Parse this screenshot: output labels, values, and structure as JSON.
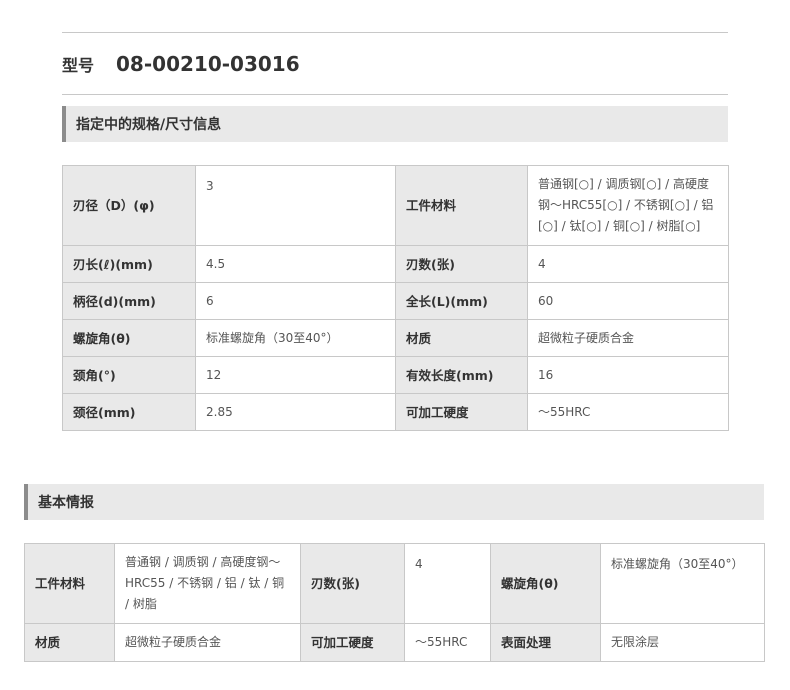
{
  "model": {
    "label": "型号",
    "value": "08-00210-03016"
  },
  "spec_section": {
    "title": "指定中的规格/尺寸信息",
    "rows": [
      {
        "k1": "刃径（D）(φ)",
        "v1": "3",
        "k2": "工件材料",
        "v2": "普通钢[○] / 调质钢[○] / 高硬度钢～HRC55[○] / 不锈钢[○] / 铝[○] / 钛[○] / 铜[○] / 树脂[○]"
      },
      {
        "k1": "刃长(ℓ)(mm)",
        "v1": "4.5",
        "k2": "刃数(张)",
        "v2": "4"
      },
      {
        "k1": "柄径(d)(mm)",
        "v1": "6",
        "k2": "全长(L)(mm)",
        "v2": "60"
      },
      {
        "k1": "螺旋角(θ)",
        "v1": "标准螺旋角（30至40°）",
        "k2": "材质",
        "v2": "超微粒子硬质合金"
      },
      {
        "k1": "颈角(°)",
        "v1": "12",
        "k2": "有效长度(mm)",
        "v2": "16"
      },
      {
        "k1": "颈径(mm)",
        "v1": "2.85",
        "k2": "可加工硬度",
        "v2": "～55HRC"
      }
    ]
  },
  "basic_section": {
    "title": "基本情报",
    "rows": [
      {
        "k1": "工件材料",
        "v1": "普通钢 / 调质钢 / 高硬度钢～HRC55 / 不锈钢 / 铝 / 钛 / 铜 / 树脂",
        "k2": "刃数(张)",
        "v2": "4",
        "k3": "螺旋角(θ)",
        "v3": "标准螺旋角（30至40°）"
      },
      {
        "k1": "材质",
        "v1": "超微粒子硬质合金",
        "k2": "可加工硬度",
        "v2": "～55HRC",
        "k3": "表面处理",
        "v3": "无限涂层"
      }
    ]
  }
}
